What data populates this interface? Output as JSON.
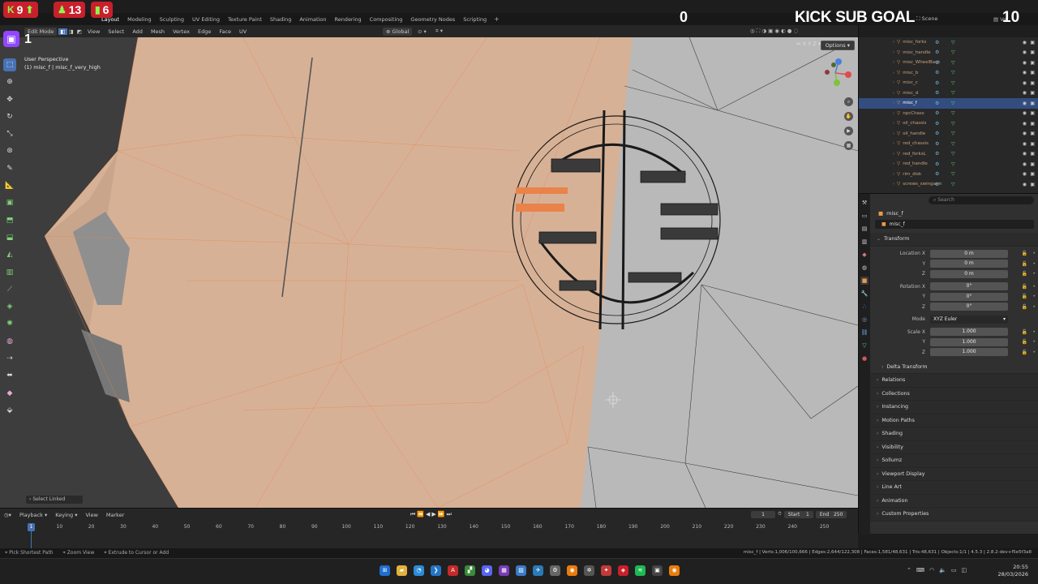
{
  "stream_overlay": {
    "followers": "9",
    "viewers": "13",
    "likes": "6",
    "sub_count": "0",
    "goal_label": "KICK SUB GOAL",
    "goal_target": "10",
    "channel_count": "1",
    "colors": {
      "badge": "#c8202b",
      "accent": "#8ff54e"
    }
  },
  "menu": {
    "workspaces": [
      "Layout",
      "Modeling",
      "Sculpting",
      "UV Editing",
      "Texture Paint",
      "Shading",
      "Animation",
      "Rendering",
      "Compositing",
      "Geometry Nodes",
      "Scripting"
    ],
    "active_workspace": "Layout",
    "scene_label": "Scene",
    "view_layer": "Ve"
  },
  "viewport_header": {
    "mode": "Edit Mode",
    "menus": [
      "View",
      "Select",
      "Add",
      "Mesh",
      "Vertex",
      "Edge",
      "Face",
      "UV"
    ],
    "orientation": "Global",
    "options": "Options",
    "axes": "X Y Z"
  },
  "viewport": {
    "perspective": "User Perspective",
    "object_info": "(1) misc_f | misc_f_very_high",
    "operator": "Select Linked",
    "colors": {
      "background": "#3d3d3d",
      "selection": "#e9834a",
      "mesh_fill": "#d8b196"
    }
  },
  "outliner": {
    "search": "",
    "items": [
      {
        "name": "misc_forks",
        "selected": false
      },
      {
        "name": "misc_handle",
        "selected": false
      },
      {
        "name": "misc_WheelBack",
        "selected": false
      },
      {
        "name": "misc_b",
        "selected": false
      },
      {
        "name": "misc_c",
        "selected": false
      },
      {
        "name": "misc_d",
        "selected": false
      },
      {
        "name": "misc_f",
        "selected": true
      },
      {
        "name": "npcChass",
        "selected": false
      },
      {
        "name": "oil_chassis",
        "selected": false
      },
      {
        "name": "oil_handle",
        "selected": false
      },
      {
        "name": "red_chassis",
        "selected": false
      },
      {
        "name": "red_forksL",
        "selected": false
      },
      {
        "name": "red_handle",
        "selected": false
      },
      {
        "name": "rim_disk",
        "selected": false
      },
      {
        "name": "screws_swingarm",
        "selected": false
      }
    ]
  },
  "properties": {
    "search_placeholder": "Search",
    "object_name": "misc_f",
    "object_field": "misc_f",
    "transform_label": "Transform",
    "location_x_label": "Location X",
    "location_x": "0 m",
    "location_y": "0 m",
    "location_z": "0 m",
    "rotation_x_label": "Rotation X",
    "rotation_x": "0°",
    "rotation_y": "0°",
    "rotation_z": "0°",
    "mode_label": "Mode",
    "mode_value": "XYZ Euler",
    "scale_x_label": "Scale X",
    "scale_x": "1.000",
    "scale_y": "1.000",
    "scale_z": "1.000",
    "y_label": "Y",
    "z_label": "Z",
    "delta": "Delta Transform",
    "panels": [
      "Relations",
      "Collections",
      "Instancing",
      "Motion Paths",
      "Shading",
      "Visibility",
      "Sollumz",
      "Viewport Display",
      "Line Art",
      "Animation",
      "Custom Properties"
    ]
  },
  "timeline": {
    "menus": [
      "Playback",
      "Keying",
      "View",
      "Marker"
    ],
    "current_frame": "1",
    "start_label": "Start",
    "start": "1",
    "end_label": "End",
    "end": "250",
    "ticks": [
      "10",
      "20",
      "30",
      "40",
      "50",
      "60",
      "70",
      "80",
      "90",
      "100",
      "110",
      "120",
      "130",
      "140",
      "150",
      "160",
      "170",
      "180",
      "190",
      "200",
      "210",
      "220",
      "230",
      "240",
      "250"
    ],
    "playhead": "1"
  },
  "statusbar": {
    "left": [
      "Pick Shortest Path",
      "Zoom View",
      "Extrude to Cursor or Add"
    ],
    "right": "misc_f | Verts:1,006/100,666 | Edges:2,644/122,308 | Faces:1,581/48,631 | Tris:48,631 | Objects:1/1 | 4.5.3 | 2.8.2-dev+f5e5f3a8"
  },
  "taskbar": {
    "time": "20:55",
    "date": "28/03/2026"
  }
}
